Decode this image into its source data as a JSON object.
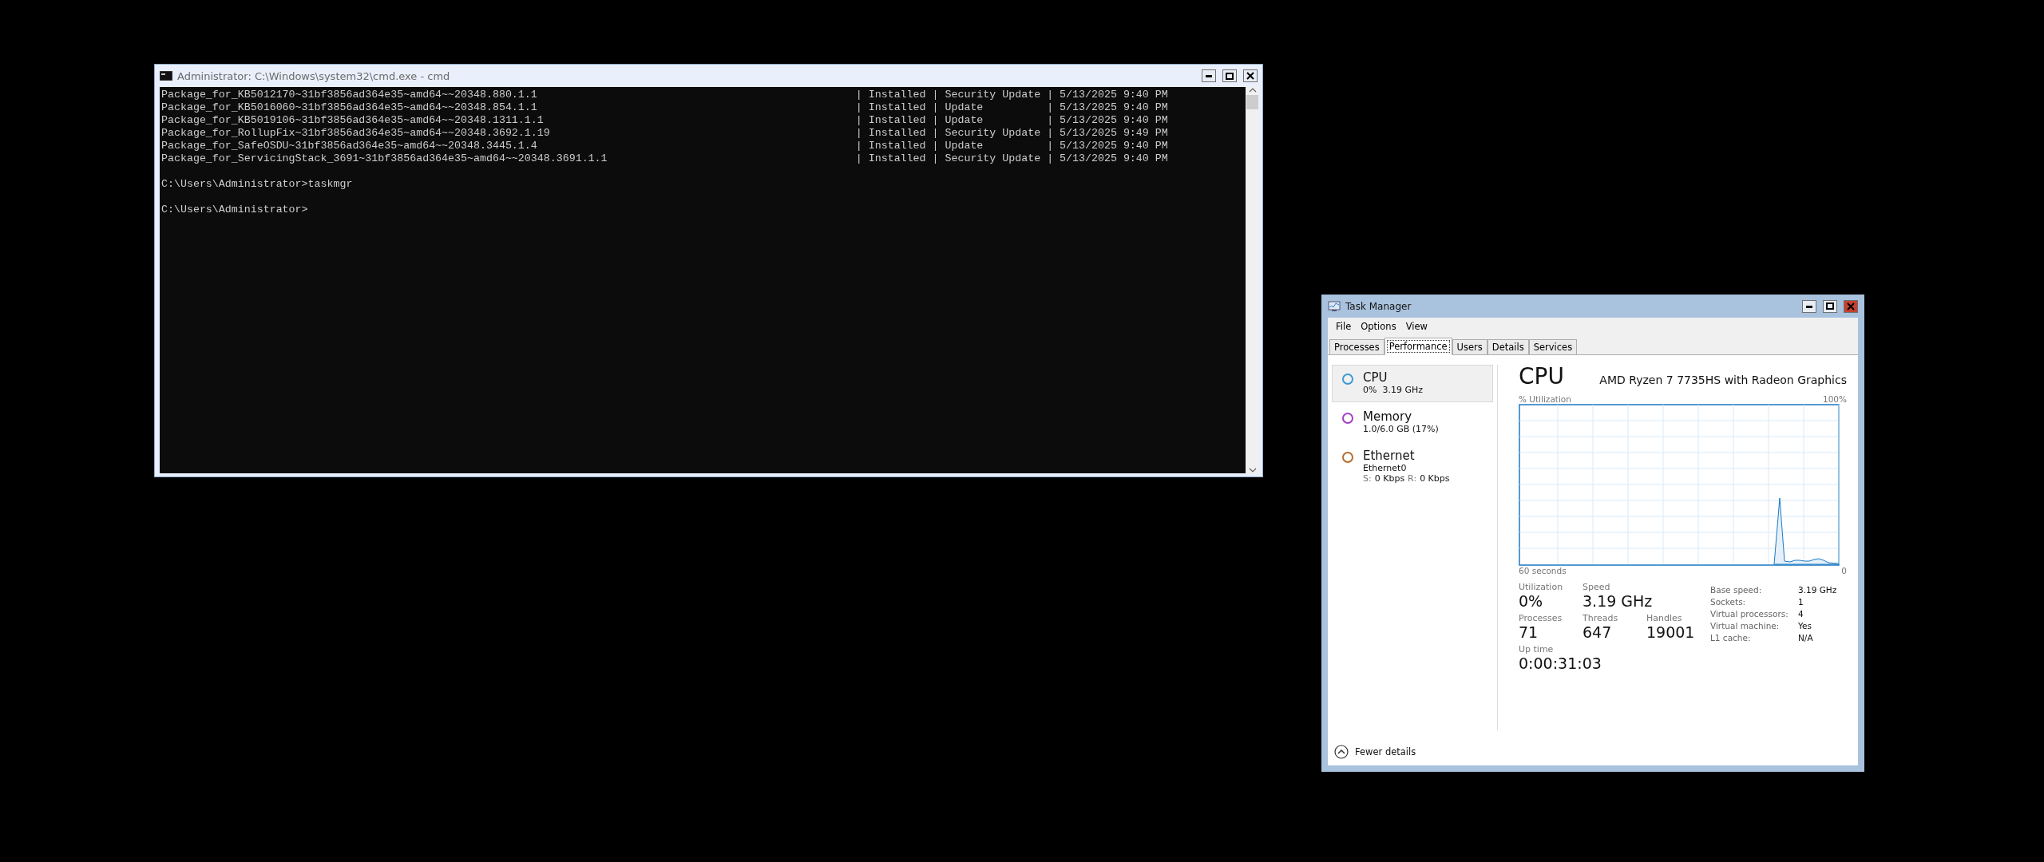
{
  "cmd_window": {
    "title": "Administrator: C:\\Windows\\system32\\cmd.exe - cmd",
    "rows": [
      {
        "package": "Package_for_KB5012170~31bf3856ad364e35~amd64~~20348.880.1.1",
        "details": "| Installed | Security Update | 5/13/2025 9:40 PM"
      },
      {
        "package": "Package_for_KB5016060~31bf3856ad364e35~amd64~~20348.854.1.1",
        "details": "| Installed | Update          | 5/13/2025 9:40 PM"
      },
      {
        "package": "Package_for_KB5019106~31bf3856ad364e35~amd64~~20348.1311.1.1",
        "details": "| Installed | Update          | 5/13/2025 9:40 PM"
      },
      {
        "package": "Package_for_RollupFix~31bf3856ad364e35~amd64~~20348.3692.1.19",
        "details": "| Installed | Security Update | 5/13/2025 9:49 PM"
      },
      {
        "package": "Package_for_SafeOSDU~31bf3856ad364e35~amd64~~20348.3445.1.4",
        "details": "| Installed | Update          | 5/13/2025 9:40 PM"
      },
      {
        "package": "Package_for_ServicingStack_3691~31bf3856ad364e35~amd64~~20348.3691.1.1",
        "details": "| Installed | Security Update | 5/13/2025 9:40 PM"
      }
    ],
    "prompts": [
      "C:\\Users\\Administrator>taskmgr",
      "C:\\Users\\Administrator>"
    ]
  },
  "task_manager": {
    "title": "Task Manager",
    "menu": [
      "File",
      "Options",
      "View"
    ],
    "tabs": [
      {
        "label": "Processes",
        "selected": false
      },
      {
        "label": "Performance",
        "selected": true
      },
      {
        "label": "Users",
        "selected": false
      },
      {
        "label": "Details",
        "selected": false
      },
      {
        "label": "Services",
        "selected": false
      }
    ],
    "resources": [
      {
        "name": "CPU",
        "color": "#3c9ad6",
        "selected": true,
        "lines": [
          {
            "kind": "text",
            "text": "0%  3.19 GHz"
          }
        ]
      },
      {
        "name": "Memory",
        "color": "#a43fbf",
        "selected": false,
        "lines": [
          {
            "kind": "text",
            "text": "1.0/6.0 GB (17%)"
          }
        ]
      },
      {
        "name": "Ethernet",
        "color": "#b86a2c",
        "selected": false,
        "lines": [
          {
            "kind": "text",
            "text": "Ethernet0"
          },
          {
            "kind": "rate",
            "parts": [
              {
                "label": "S:",
                "value": "0 Kbps"
              },
              {
                "label": "R:",
                "value": "0 Kbps"
              }
            ]
          }
        ]
      }
    ],
    "header": {
      "title": "CPU",
      "model": "AMD Ryzen 7 7735HS with Radeon Graphics"
    },
    "graph": {
      "label": "% Utilization",
      "max": "100%",
      "span": "60 seconds",
      "min": "0"
    },
    "stats": [
      [
        {
          "label": "Utilization",
          "value": "0%"
        },
        {
          "label": "Speed",
          "value": "3.19 GHz"
        }
      ],
      [
        {
          "label": "Processes",
          "value": "71"
        },
        {
          "label": "Threads",
          "value": "647"
        },
        {
          "label": "Handles",
          "value": "19001"
        }
      ],
      [
        {
          "label": "Up time",
          "value": "0:00:31:03"
        }
      ]
    ],
    "details": [
      {
        "label": "Base speed:",
        "value": "3.19 GHz"
      },
      {
        "label": "Sockets:",
        "value": "1"
      },
      {
        "label": "Virtual processors:",
        "value": "4"
      },
      {
        "label": "Virtual machine:",
        "value": "Yes"
      },
      {
        "label": "L1 cache:",
        "value": "N/A"
      }
    ],
    "footer": "Fewer details"
  }
}
